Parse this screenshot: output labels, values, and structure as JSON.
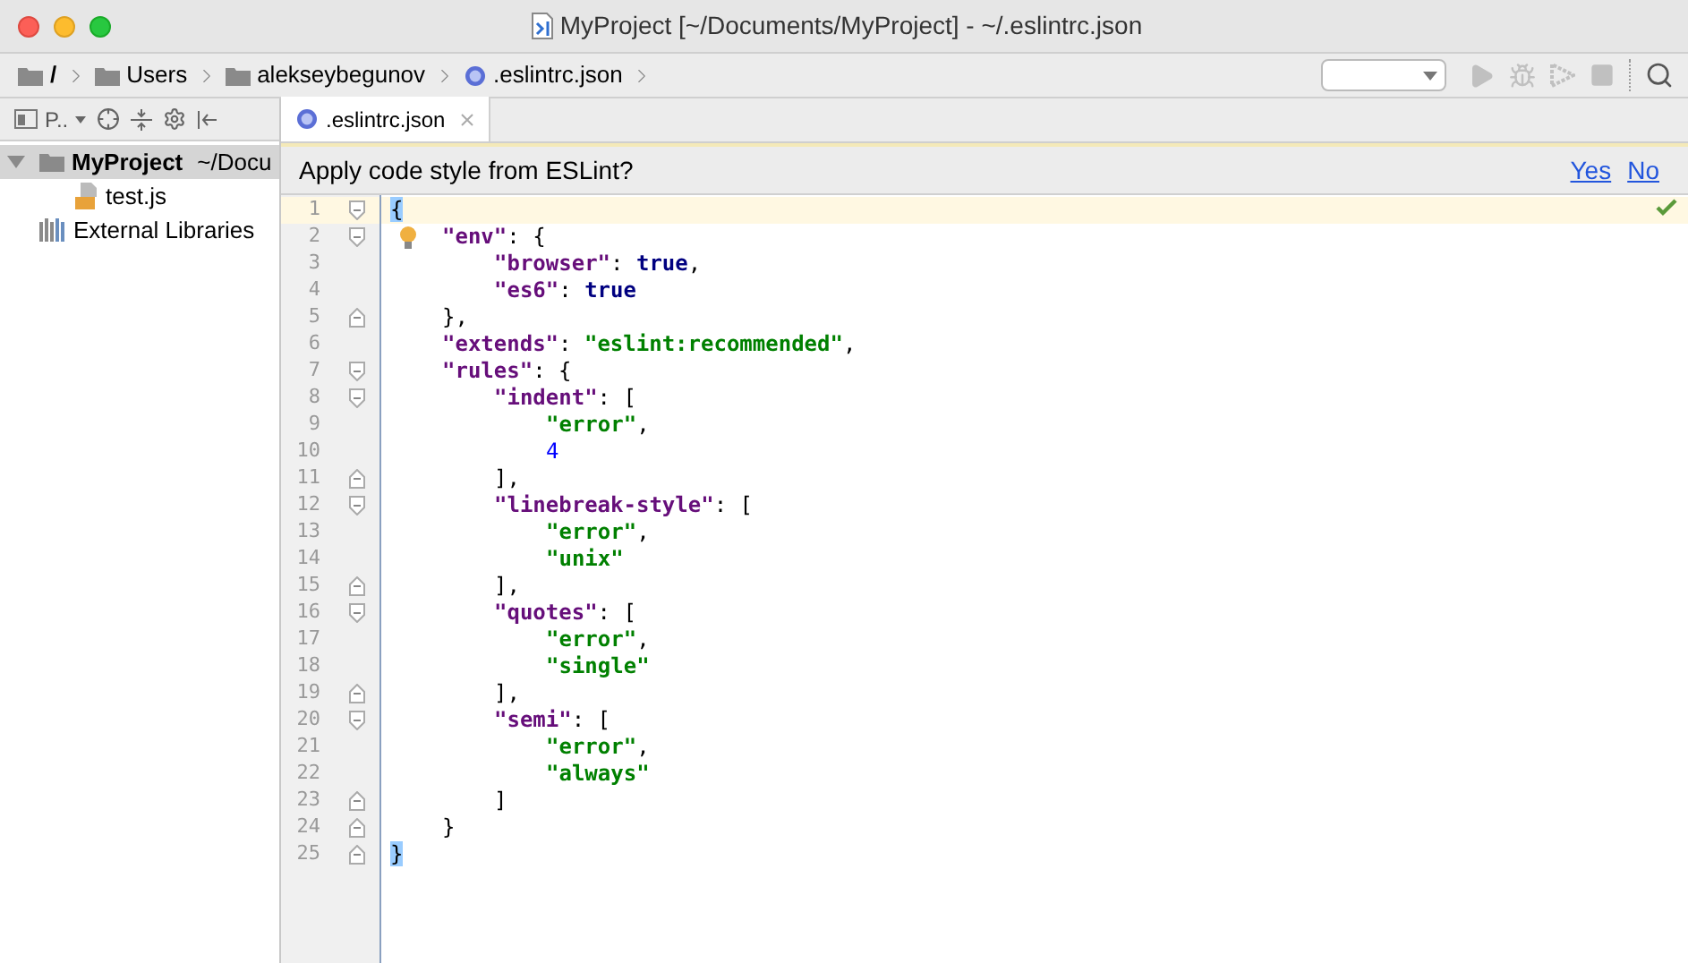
{
  "window": {
    "title": "MyProject [~/Documents/MyProject] - ~/.eslintrc.json"
  },
  "breadcrumbs": [
    {
      "label": "/",
      "kind": "folder"
    },
    {
      "label": "Users",
      "kind": "folder"
    },
    {
      "label": "alekseybegunov",
      "kind": "folder"
    },
    {
      "label": ".eslintrc.json",
      "kind": "config"
    }
  ],
  "project_panel": {
    "view_label": "P..",
    "items": [
      {
        "label": "MyProject",
        "suffix": "~/Docu",
        "kind": "project",
        "expanded": true,
        "children": [
          {
            "label": "test.js",
            "kind": "js"
          }
        ]
      },
      {
        "label": "External Libraries",
        "kind": "library"
      }
    ]
  },
  "tabs": [
    {
      "label": ".eslintrc.json",
      "selected": true
    }
  ],
  "notification": {
    "message": "Apply code style from ESLint?",
    "actions": [
      "Yes",
      "No"
    ]
  },
  "editor": {
    "lines": [
      {
        "number": "1",
        "current": true,
        "fold_start": true,
        "fold_end": false,
        "hint": false,
        "tokens": [
          {
            "kind": "match",
            "text": "{"
          }
        ]
      },
      {
        "number": "2",
        "current": false,
        "fold_start": true,
        "fold_end": false,
        "hint": true,
        "tokens": [
          {
            "kind": "key",
            "text": "\"env\""
          },
          {
            "kind": "punct",
            "text": ": {"
          }
        ]
      },
      {
        "number": "3",
        "current": false,
        "fold_start": false,
        "fold_end": false,
        "hint": false,
        "tokens": [
          {
            "kind": "key",
            "text": "\"browser\""
          },
          {
            "kind": "punct",
            "text": ": "
          },
          {
            "kind": "kw",
            "text": "true"
          },
          {
            "kind": "punct",
            "text": ","
          }
        ]
      },
      {
        "number": "4",
        "current": false,
        "fold_start": false,
        "fold_end": false,
        "hint": false,
        "tokens": [
          {
            "kind": "key",
            "text": "\"es6\""
          },
          {
            "kind": "punct",
            "text": ": "
          },
          {
            "kind": "kw",
            "text": "true"
          }
        ]
      },
      {
        "number": "5",
        "current": false,
        "fold_start": false,
        "fold_end": true,
        "hint": false,
        "tokens": [
          {
            "kind": "punct",
            "text": "},"
          }
        ]
      },
      {
        "number": "6",
        "current": false,
        "fold_start": false,
        "fold_end": false,
        "hint": false,
        "tokens": [
          {
            "kind": "key",
            "text": "\"extends\""
          },
          {
            "kind": "punct",
            "text": ": "
          },
          {
            "kind": "str",
            "text": "\"eslint:recommended\""
          },
          {
            "kind": "punct",
            "text": ","
          }
        ]
      },
      {
        "number": "7",
        "current": false,
        "fold_start": true,
        "fold_end": false,
        "hint": false,
        "tokens": [
          {
            "kind": "key",
            "text": "\"rules\""
          },
          {
            "kind": "punct",
            "text": ": {"
          }
        ]
      },
      {
        "number": "8",
        "current": false,
        "fold_start": true,
        "fold_end": false,
        "hint": false,
        "tokens": [
          {
            "kind": "key",
            "text": "\"indent\""
          },
          {
            "kind": "punct",
            "text": ": ["
          }
        ]
      },
      {
        "number": "9",
        "current": false,
        "fold_start": false,
        "fold_end": false,
        "hint": false,
        "tokens": [
          {
            "kind": "str",
            "text": "\"error\""
          },
          {
            "kind": "punct",
            "text": ","
          }
        ]
      },
      {
        "number": "10",
        "current": false,
        "fold_start": false,
        "fold_end": false,
        "hint": false,
        "tokens": [
          {
            "kind": "num",
            "text": "4"
          }
        ]
      },
      {
        "number": "11",
        "current": false,
        "fold_start": false,
        "fold_end": true,
        "hint": false,
        "tokens": [
          {
            "kind": "punct",
            "text": "],"
          }
        ]
      },
      {
        "number": "12",
        "current": false,
        "fold_start": true,
        "fold_end": false,
        "hint": false,
        "tokens": [
          {
            "kind": "key",
            "text": "\"linebreak-style\""
          },
          {
            "kind": "punct",
            "text": ": ["
          }
        ]
      },
      {
        "number": "13",
        "current": false,
        "fold_start": false,
        "fold_end": false,
        "hint": false,
        "tokens": [
          {
            "kind": "str",
            "text": "\"error\""
          },
          {
            "kind": "punct",
            "text": ","
          }
        ]
      },
      {
        "number": "14",
        "current": false,
        "fold_start": false,
        "fold_end": false,
        "hint": false,
        "tokens": [
          {
            "kind": "str",
            "text": "\"unix\""
          }
        ]
      },
      {
        "number": "15",
        "current": false,
        "fold_start": false,
        "fold_end": true,
        "hint": false,
        "tokens": [
          {
            "kind": "punct",
            "text": "],"
          }
        ]
      },
      {
        "number": "16",
        "current": false,
        "fold_start": true,
        "fold_end": false,
        "hint": false,
        "tokens": [
          {
            "kind": "key",
            "text": "\"quotes\""
          },
          {
            "kind": "punct",
            "text": ": ["
          }
        ]
      },
      {
        "number": "17",
        "current": false,
        "fold_start": false,
        "fold_end": false,
        "hint": false,
        "tokens": [
          {
            "kind": "str",
            "text": "\"error\""
          },
          {
            "kind": "punct",
            "text": ","
          }
        ]
      },
      {
        "number": "18",
        "current": false,
        "fold_start": false,
        "fold_end": false,
        "hint": false,
        "tokens": [
          {
            "kind": "str",
            "text": "\"single\""
          }
        ]
      },
      {
        "number": "19",
        "current": false,
        "fold_start": false,
        "fold_end": true,
        "hint": false,
        "tokens": [
          {
            "kind": "punct",
            "text": "],"
          }
        ]
      },
      {
        "number": "20",
        "current": false,
        "fold_start": true,
        "fold_end": false,
        "hint": false,
        "tokens": [
          {
            "kind": "key",
            "text": "\"semi\""
          },
          {
            "kind": "punct",
            "text": ": ["
          }
        ]
      },
      {
        "number": "21",
        "current": false,
        "fold_start": false,
        "fold_end": false,
        "hint": false,
        "tokens": [
          {
            "kind": "str",
            "text": "\"error\""
          },
          {
            "kind": "punct",
            "text": ","
          }
        ]
      },
      {
        "number": "22",
        "current": false,
        "fold_start": false,
        "fold_end": false,
        "hint": false,
        "tokens": [
          {
            "kind": "str",
            "text": "\"always\""
          }
        ]
      },
      {
        "number": "23",
        "current": false,
        "fold_start": false,
        "fold_end": true,
        "hint": false,
        "tokens": [
          {
            "kind": "punct",
            "text": "]"
          }
        ]
      },
      {
        "number": "24",
        "current": false,
        "fold_start": false,
        "fold_end": true,
        "hint": false,
        "tokens": [
          {
            "kind": "punct",
            "text": "}"
          }
        ]
      },
      {
        "number": "25",
        "current": false,
        "fold_start": false,
        "fold_end": true,
        "hint": false,
        "tokens": [
          {
            "kind": "match",
            "text": "}"
          }
        ]
      }
    ]
  }
}
